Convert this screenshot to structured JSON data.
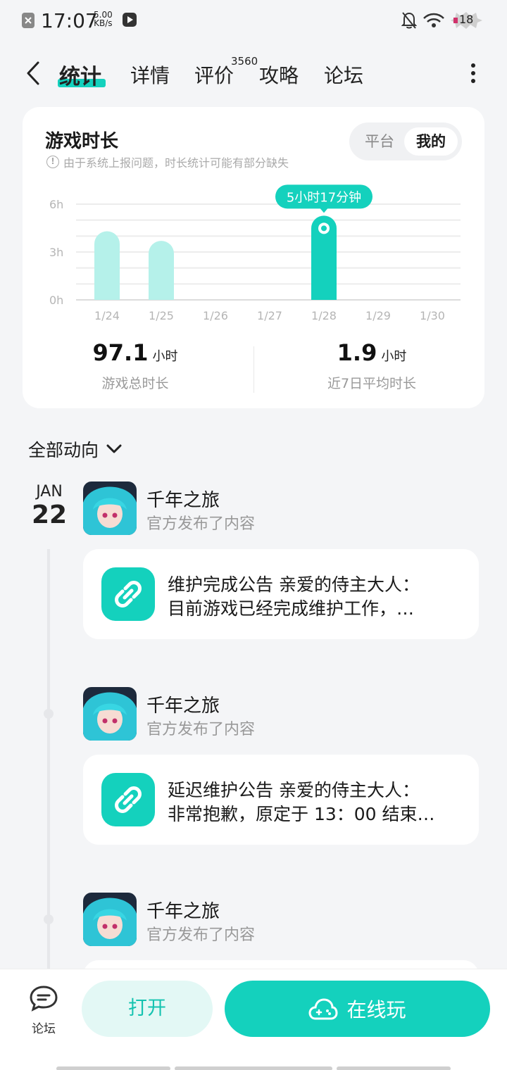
{
  "status_bar": {
    "time": "17:07",
    "net_speed_value": "5.00",
    "net_speed_unit": "KB/s",
    "battery": "18",
    "icons": [
      "close-box-icon",
      "play-box-icon",
      "bell-off-icon",
      "wifi-icon",
      "battery-icon"
    ]
  },
  "header": {
    "back_icon": "chevron-left-icon",
    "tabs": [
      {
        "label": "统计",
        "active": true
      },
      {
        "label": "详情",
        "active": false
      },
      {
        "label": "评价",
        "active": false
      },
      {
        "label": "攻略",
        "active": false
      },
      {
        "label": "论坛",
        "active": false
      }
    ],
    "review_badge": "3560",
    "more_icon": "more-vertical-icon"
  },
  "stats_card": {
    "title": "游戏时长",
    "notice": "由于系统上报问题，时长统计可能有部分缺失",
    "toggle": {
      "options": [
        "平台",
        "我的"
      ],
      "selected": "我的"
    },
    "highlight_label": "5小时17分钟",
    "summary": [
      {
        "value": "97.1",
        "unit": "小时",
        "label": "游戏总时长"
      },
      {
        "value": "1.9",
        "unit": "小时",
        "label": "近7日平均时长"
      }
    ]
  },
  "chart_data": {
    "type": "bar",
    "categories": [
      "1/24",
      "1/25",
      "1/26",
      "1/27",
      "1/28",
      "1/29",
      "1/30"
    ],
    "values": [
      4.3,
      3.7,
      0,
      0,
      5.28,
      0,
      0
    ],
    "highlighted_index": 4,
    "y_ticks": [
      "6h",
      "3h",
      "0h"
    ],
    "ylim": [
      0,
      6
    ],
    "grid": true,
    "colors": {
      "bar": "#b5f1ea",
      "bar_highlight": "#14d1bd"
    }
  },
  "feed": {
    "filter_label": "全部动向",
    "date": {
      "month": "JAN",
      "day": "22"
    },
    "posts": [
      {
        "name": "千年之旅",
        "subtitle": "官方发布了内容",
        "line1": "维护完成公告 亲爱的侍主大人：",
        "line2": "目前游戏已经完成维护工作，…"
      },
      {
        "name": "千年之旅",
        "subtitle": "官方发布了内容",
        "line1": "延迟维护公告 亲爱的侍主大人：",
        "line2": "非常抱歉，原定于 13：00 结束…"
      },
      {
        "name": "千年之旅",
        "subtitle": "官方发布了内容",
        "line1": "",
        "line2": ""
      }
    ]
  },
  "bottom_bar": {
    "forum_label": "论坛",
    "open_label": "打开",
    "play_label": "在线玩"
  },
  "colors": {
    "accent": "#14d1bd",
    "accent_light": "#e3f8f5"
  }
}
